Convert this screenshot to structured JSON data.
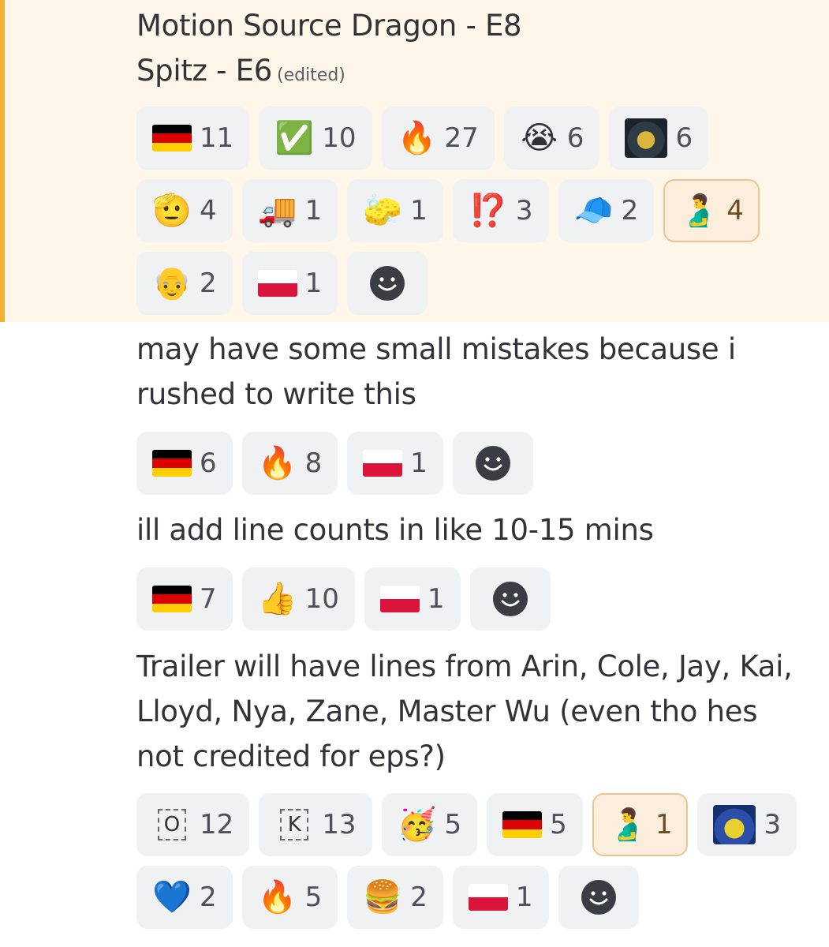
{
  "messages": [
    {
      "lines": [
        "Motion Source Dragon - E8",
        "Spitz - E6"
      ],
      "edited_label": "(edited)",
      "highlighted": true,
      "reaction_rows": [
        [
          {
            "icon": "germany-flag-icon",
            "count": "11"
          },
          {
            "icon": "check-mark-button-icon",
            "count": "10"
          },
          {
            "icon": "fire-icon",
            "count": "27"
          },
          {
            "icon": "loudly-crying-face-icon",
            "count": "6"
          },
          {
            "icon": "custom-lego-minifig-icon",
            "count": "6"
          }
        ],
        [
          {
            "icon": "saluting-face-icon",
            "count": "4"
          },
          {
            "icon": "delivery-truck-icon",
            "count": "1"
          },
          {
            "icon": "sponge-icon",
            "count": "1"
          },
          {
            "icon": "exclamation-question-mark-icon",
            "count": "3"
          },
          {
            "icon": "billed-cap-icon",
            "count": "2"
          },
          {
            "icon": "pregnant-man-icon",
            "count": "4",
            "me": true
          }
        ],
        [
          {
            "icon": "old-man-icon",
            "count": "2"
          },
          {
            "icon": "poland-flag-icon",
            "count": "1"
          },
          {
            "icon": "add-reaction-icon",
            "add": true
          }
        ]
      ]
    },
    {
      "lines": [
        "may have some small mistakes because i",
        "rushed to write this"
      ],
      "reaction_rows": [
        [
          {
            "icon": "germany-flag-icon",
            "count": "6"
          },
          {
            "icon": "fire-icon",
            "count": "8"
          },
          {
            "icon": "poland-flag-icon",
            "count": "1"
          },
          {
            "icon": "add-reaction-icon",
            "add": true
          }
        ]
      ]
    },
    {
      "lines": [
        "ill add line counts in like 10-15 mins"
      ],
      "reaction_rows": [
        [
          {
            "icon": "germany-flag-icon",
            "count": "7"
          },
          {
            "icon": "thumbs-up-icon",
            "count": "10"
          },
          {
            "icon": "poland-flag-icon",
            "count": "1"
          },
          {
            "icon": "add-reaction-icon",
            "add": true
          }
        ]
      ]
    },
    {
      "lines": [
        "Trailer will have lines from Arin, Cole, Jay, Kai,",
        "Lloyd, Nya, Zane, Master  Wu (even tho hes",
        "not credited for eps?)"
      ],
      "reaction_rows": [
        [
          {
            "icon": "regional-indicator-o-icon",
            "glyph": "O",
            "count": "12"
          },
          {
            "icon": "regional-indicator-k-icon",
            "glyph": "K",
            "count": "13"
          },
          {
            "icon": "partying-face-icon",
            "count": "5"
          },
          {
            "icon": "germany-flag-icon",
            "count": "5"
          },
          {
            "icon": "pregnant-man-icon",
            "count": "1",
            "me": true
          },
          {
            "icon": "custom-lego-minifig-2-icon",
            "count": "3"
          }
        ],
        [
          {
            "icon": "blue-heart-icon",
            "count": "2"
          },
          {
            "icon": "fire-icon",
            "count": "5"
          },
          {
            "icon": "hamburger-icon",
            "count": "2"
          },
          {
            "icon": "poland-flag-icon",
            "count": "1"
          },
          {
            "icon": "add-reaction-icon",
            "add": true
          }
        ]
      ]
    }
  ],
  "colors": {
    "highlight_bg": "#fdf6e9",
    "highlight_bar": "#f0b232",
    "chip_bg": "#f0f1f3",
    "chip_me_bg": "#fbeedd",
    "chip_me_border": "#ecc491",
    "text": "#313338"
  }
}
